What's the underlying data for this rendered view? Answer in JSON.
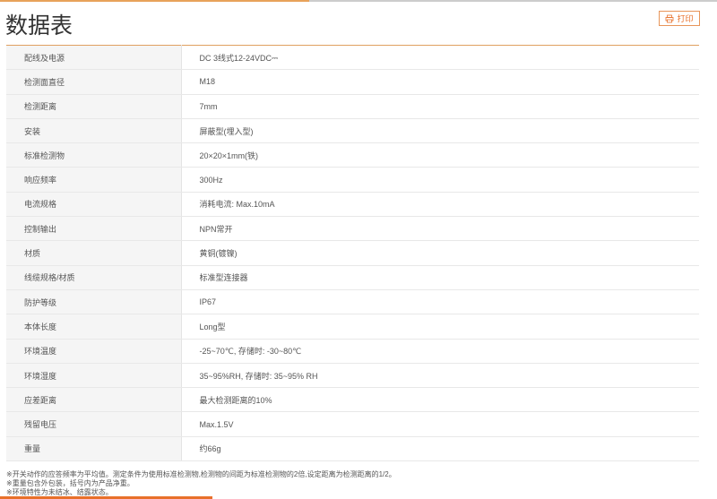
{
  "title": "数据表",
  "print_label": "打印",
  "colors": {
    "accent": "#e8702a"
  },
  "rows": [
    {
      "k": "配线及电源",
      "v": "DC 3线式12-24VDC⎓"
    },
    {
      "k": "检测面直径",
      "v": "M18"
    },
    {
      "k": "检测距离",
      "v": "7mm"
    },
    {
      "k": "安装",
      "v": "屏蔽型(埋入型)"
    },
    {
      "k": "标准检测物",
      "v": "20×20×1mm(铁)"
    },
    {
      "k": "响应频率",
      "v": "300Hz"
    },
    {
      "k": "电流规格",
      "v": "消耗电流: Max.10mA"
    },
    {
      "k": "控制输出",
      "v": "NPN常开"
    },
    {
      "k": "材质",
      "v": "黄铜(镀镍)"
    },
    {
      "k": "线缆规格/材质",
      "v": "标准型连接器"
    },
    {
      "k": "防护等级",
      "v": "IP67"
    },
    {
      "k": "本体长度",
      "v": "Long型"
    },
    {
      "k": "环境温度",
      "v": "-25~70℃, 存储时: -30~80℃"
    },
    {
      "k": "环境湿度",
      "v": "35~95%RH, 存储时: 35~95% RH"
    },
    {
      "k": "应差距离",
      "v": "最大检测距离的10%"
    },
    {
      "k": "残留电压",
      "v": "Max.1.5V"
    },
    {
      "k": "重量",
      "v": "约66g"
    }
  ],
  "notes": [
    "※开关动作的应答频率为平均值。测定条件为使用标准检测物,检测物的间距为标准检测物的2倍,设定距离为检测距离的1/2。",
    "※重量包含外包装，括号内为产品净重。",
    "※环境特性为未结冰、结露状态。"
  ]
}
